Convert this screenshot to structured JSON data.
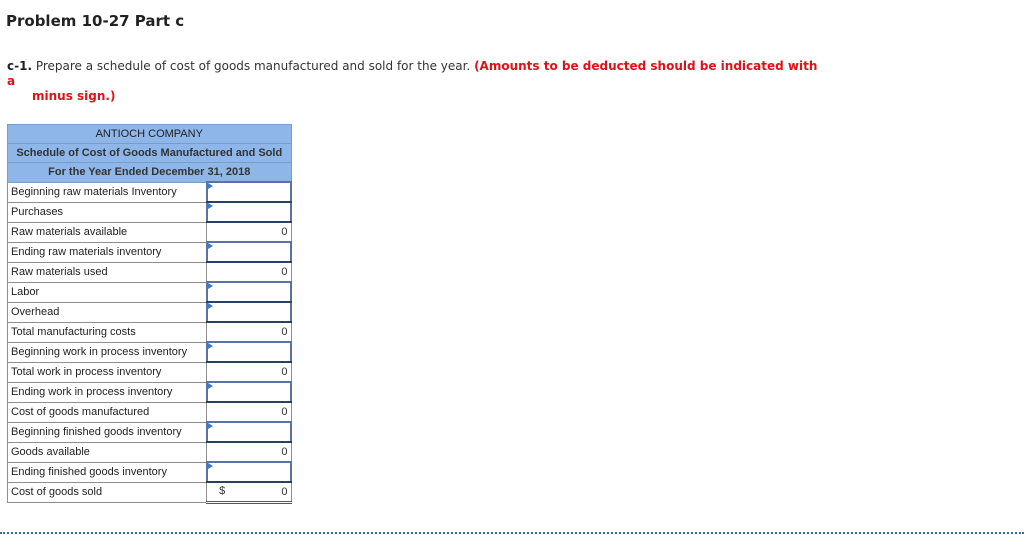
{
  "page": {
    "title": "Problem 10-27 Part c"
  },
  "instructions": {
    "question_number": "c-1.",
    "text": " Prepare a schedule of cost of goods manufactured and sold for the year. ",
    "note_line1": "(Amounts to be deducted should be indicated with a",
    "note_line2": "minus sign.)"
  },
  "schedule": {
    "company": "ANTIOCH COMPANY",
    "title": "Schedule of Cost of Goods Manufactured and Sold",
    "period": "For the Year Ended December 31, 2018",
    "rows": [
      {
        "label": "Beginning raw materials Inventory",
        "type": "input",
        "value": ""
      },
      {
        "label": "Purchases",
        "type": "input",
        "value": ""
      },
      {
        "label": "Raw materials available",
        "type": "calc",
        "value": "0"
      },
      {
        "label": "Ending raw materials inventory",
        "type": "input",
        "value": ""
      },
      {
        "label": "Raw materials used",
        "type": "calc",
        "value": "0"
      },
      {
        "label": "Labor",
        "type": "input",
        "value": ""
      },
      {
        "label": "Overhead",
        "type": "input",
        "value": ""
      },
      {
        "label": "Total manufacturing costs",
        "type": "calc",
        "value": "0"
      },
      {
        "label": "Beginning work in process inventory",
        "type": "input",
        "value": ""
      },
      {
        "label": "Total work in process inventory",
        "type": "calc",
        "value": "0"
      },
      {
        "label": "Ending work in process inventory",
        "type": "input",
        "value": ""
      },
      {
        "label": "Cost of goods manufactured",
        "type": "calc",
        "value": "0"
      },
      {
        "label": "Beginning finished goods inventory",
        "type": "input",
        "value": ""
      },
      {
        "label": "Goods available",
        "type": "calc",
        "value": "0"
      },
      {
        "label": "Ending finished goods inventory",
        "type": "input",
        "value": ""
      },
      {
        "label": "Cost of goods sold",
        "type": "total",
        "currency": "$",
        "value": "0"
      }
    ]
  },
  "colors": {
    "header_bg": "#8fb6e8",
    "note_red": "#e0111b",
    "input_border": "#5a73a0"
  }
}
